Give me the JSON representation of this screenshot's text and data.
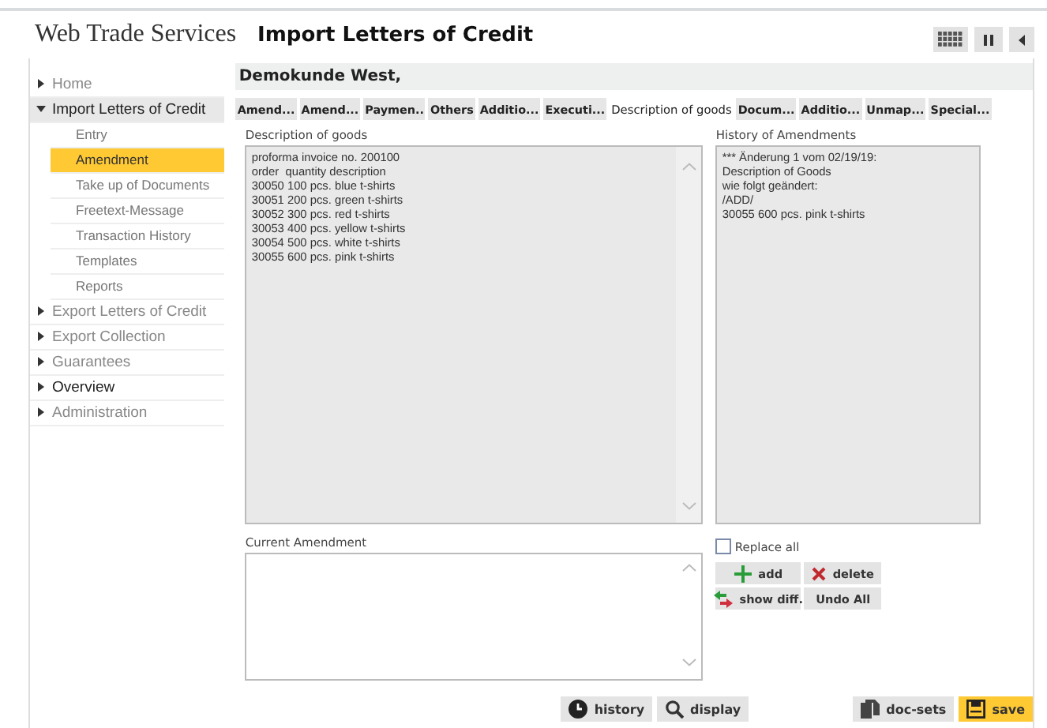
{
  "brand": "Web Trade Services",
  "page_title": "Import Letters of Credit",
  "sidebar": {
    "items": [
      {
        "label": "Home",
        "expanded": false,
        "disabled": true
      },
      {
        "label": "Import Letters of Credit",
        "expanded": true,
        "disabled": false,
        "children": [
          {
            "label": "Entry",
            "selected": false
          },
          {
            "label": "Amendment",
            "selected": true
          },
          {
            "label": "Take up of Documents",
            "selected": false
          },
          {
            "label": "Freetext-Message",
            "selected": false
          },
          {
            "label": "Transaction History",
            "selected": false
          },
          {
            "label": "Templates",
            "selected": false
          },
          {
            "label": "Reports",
            "selected": false
          }
        ]
      },
      {
        "label": "Export Letters of Credit",
        "expanded": false,
        "disabled": true
      },
      {
        "label": "Export Collection",
        "expanded": false,
        "disabled": true
      },
      {
        "label": "Guarantees",
        "expanded": false,
        "disabled": true
      },
      {
        "label": "Overview",
        "expanded": false,
        "disabled": false
      },
      {
        "label": "Administration",
        "expanded": false,
        "disabled": true
      }
    ]
  },
  "customer": "Demokunde West,",
  "tabs": [
    {
      "label": "Amend...",
      "selected": false
    },
    {
      "label": "Amend...",
      "selected": false
    },
    {
      "label": "Paymen..",
      "selected": false
    },
    {
      "label": "Others",
      "selected": false
    },
    {
      "label": "Additio...",
      "selected": false
    },
    {
      "label": "Executi...",
      "selected": false
    },
    {
      "label": "Description of goods",
      "selected": true
    },
    {
      "label": "Docum...",
      "selected": false
    },
    {
      "label": "Additio...",
      "selected": false
    },
    {
      "label": "Unmap...",
      "selected": false
    },
    {
      "label": "Special...",
      "selected": false
    }
  ],
  "description": {
    "label": "Description of goods",
    "lines": [
      "proforma invoice no. 200100",
      "order  quantity description",
      "30050 100 pcs. blue t-shirts",
      "30051 200 pcs. green t-shirts",
      "30052 300 pcs. red t-shirts",
      "30053 400 pcs. yellow t-shirts",
      "30054 500 pcs. white t-shirts",
      "30055 600 pcs. pink t-shirts"
    ]
  },
  "history": {
    "label": "History of Amendments",
    "lines": [
      "*** Änderung 1 vom 02/19/19:",
      "Description of Goods",
      "wie folgt geändert:",
      "/ADD/",
      "30055 600 pcs. pink t-shirts"
    ]
  },
  "current_amendment": {
    "label": "Current Amendment"
  },
  "replace_all": {
    "label": "Replace all",
    "checked": false
  },
  "edit_buttons": [
    {
      "label": "add",
      "kind": "add"
    },
    {
      "label": "delete",
      "kind": "delete"
    },
    {
      "label": "show diff.",
      "kind": "diff"
    },
    {
      "label": "Undo All",
      "kind": "plain"
    }
  ],
  "footer_buttons": [
    {
      "label": "history",
      "kind": "history",
      "primary": false
    },
    {
      "label": "display",
      "kind": "display",
      "primary": false
    },
    {
      "label": "doc-sets",
      "kind": "docsets",
      "primary": false
    },
    {
      "label": "save",
      "kind": "save",
      "primary": true
    }
  ]
}
